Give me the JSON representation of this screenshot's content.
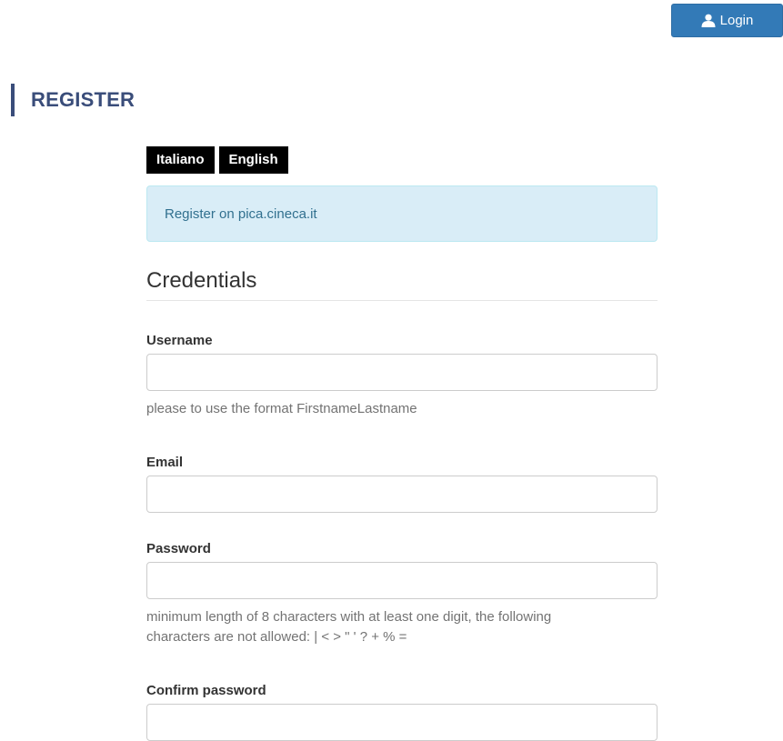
{
  "header": {
    "login_label": "Login"
  },
  "page": {
    "title": "REGISTER"
  },
  "languages": [
    {
      "label": "Italiano"
    },
    {
      "label": "English"
    }
  ],
  "info": {
    "message": "Register on pica.cineca.it"
  },
  "credentials": {
    "section_title": "Credentials",
    "username": {
      "label": "Username",
      "value": "",
      "help": "please to use the format FirstnameLastname"
    },
    "email": {
      "label": "Email",
      "value": ""
    },
    "password": {
      "label": "Password",
      "value": "",
      "help_line1": "minimum length of 8 characters with at least one digit, the following",
      "help_line2": "characters are not allowed: | < > \" ' ? + % ="
    },
    "confirm_password": {
      "label": "Confirm password",
      "value": ""
    }
  },
  "icons": {
    "login": "user-icon"
  },
  "colors": {
    "primary": "#337ab7",
    "title": "#3a4d7a",
    "info_bg": "#d9edf7",
    "info_text": "#31708f"
  }
}
